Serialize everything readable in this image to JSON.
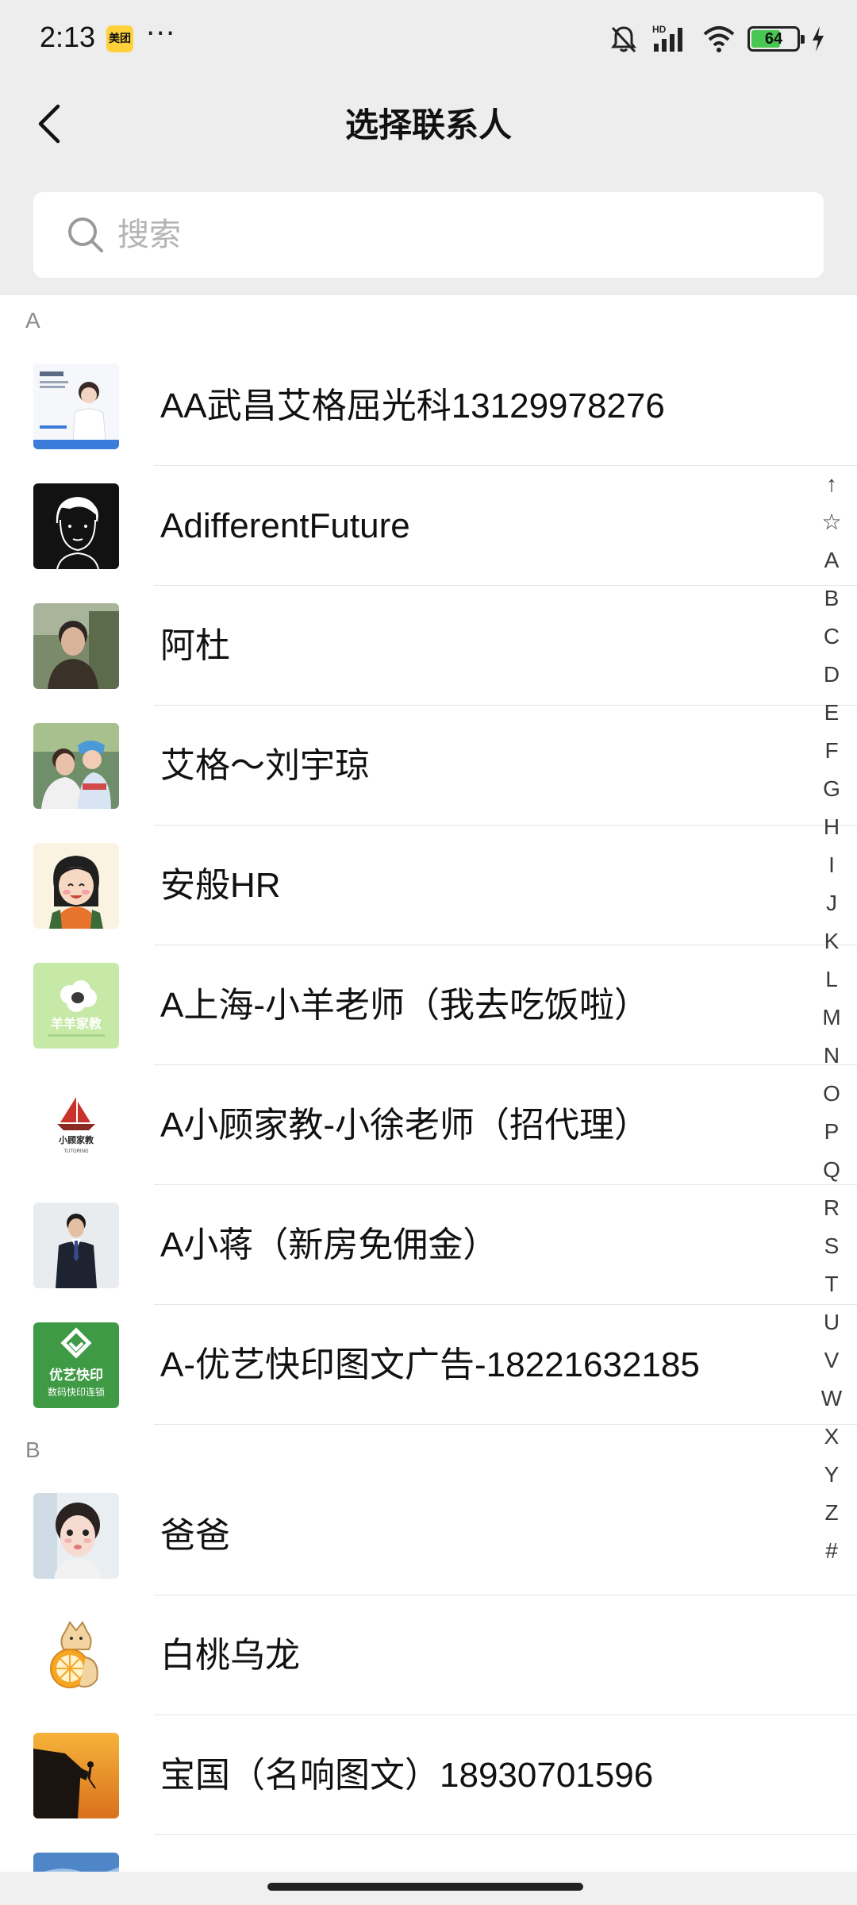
{
  "status_bar": {
    "time": "2:13",
    "app_badge": "美团",
    "dots": "···",
    "battery": "64",
    "battery_fraction": 0.64
  },
  "header": {
    "title": "选择联系人"
  },
  "search": {
    "placeholder": "搜索"
  },
  "sections": [
    {
      "letter": "A",
      "contacts": [
        {
          "name": "AA武昌艾格屈光科13129978276",
          "avatar_icon": "doctor-avatar"
        },
        {
          "name": "AdifferentFuture",
          "avatar_icon": "sketch-portrait-avatar"
        },
        {
          "name": "阿杜",
          "avatar_icon": "man-photo-avatar"
        },
        {
          "name": "艾格～刘宇琼",
          "avatar_icon": "family-photo-avatar"
        },
        {
          "name": "安般HR",
          "avatar_icon": "cartoon-girl-avatar"
        },
        {
          "name": "A上海-小羊老师（我去吃饭啦）",
          "avatar_icon": "sheep-logo-avatar"
        },
        {
          "name": "A小顾家教-小徐老师（招代理）",
          "avatar_icon": "tutoring-logo-avatar"
        },
        {
          "name": "A小蒋（新房免佣金）",
          "avatar_icon": "suit-man-avatar"
        },
        {
          "name": "A-优艺快印图文广告-18221632185",
          "avatar_icon": "print-logo-avatar"
        }
      ]
    },
    {
      "letter": "B",
      "contacts": [
        {
          "name": "爸爸",
          "avatar_icon": "child-photo-avatar"
        },
        {
          "name": "白桃乌龙",
          "avatar_icon": "cat-orange-avatar"
        },
        {
          "name": "宝国（名响图文）18930701596",
          "avatar_icon": "climber-sunset-avatar"
        }
      ]
    }
  ],
  "alpha_index": [
    "↑",
    "☆",
    "A",
    "B",
    "C",
    "D",
    "E",
    "F",
    "G",
    "H",
    "I",
    "J",
    "K",
    "L",
    "M",
    "N",
    "O",
    "P",
    "Q",
    "R",
    "S",
    "T",
    "U",
    "V",
    "W",
    "X",
    "Y",
    "Z",
    "#"
  ]
}
